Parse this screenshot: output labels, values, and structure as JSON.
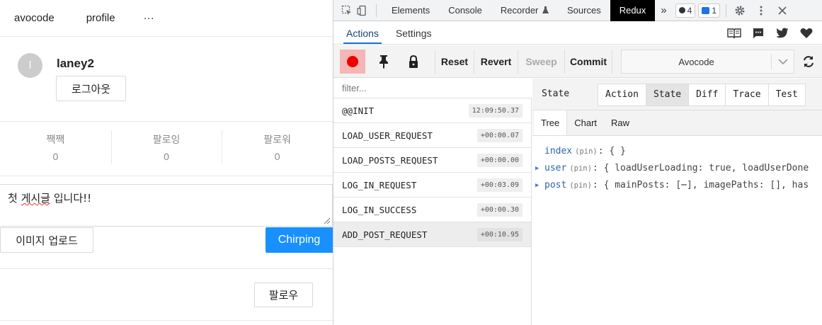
{
  "app": {
    "nav": {
      "home": "avocode",
      "profile": "profile",
      "more": "···"
    },
    "user": {
      "avatar_initial": "l",
      "name": "laney2",
      "logout_label": "로그아웃"
    },
    "stats": [
      {
        "label": "짹짹",
        "value": "0"
      },
      {
        "label": "팔로잉",
        "value": "0"
      },
      {
        "label": "팔로워",
        "value": "0"
      }
    ],
    "composer": {
      "text_before": "첫 ",
      "text_squiggle": "게시글",
      "text_after": " 입니다!!"
    },
    "upload_label": "이미지 업로드",
    "chirp_label": "Chirping",
    "follow_label": "팔로우",
    "accent_color": "#1890ff"
  },
  "devtools": {
    "tabs": [
      "Elements",
      "Console",
      "Recorder",
      "Sources",
      "Redux"
    ],
    "active_tab": "Redux",
    "more_tabs": "»",
    "badge_errors": "4",
    "badge_messages": "1",
    "redux": {
      "top_tabs": [
        "Actions",
        "Settings"
      ],
      "active_top_tab": "Actions",
      "toolbar": {
        "reset": "Reset",
        "revert": "Revert",
        "sweep": "Sweep",
        "commit": "Commit"
      },
      "instance": "Avocode",
      "filter_placeholder": "filter...",
      "actions": [
        {
          "name": "@@INIT",
          "time": "12:09:50.37"
        },
        {
          "name": "LOAD_USER_REQUEST",
          "time": "+00:00.07"
        },
        {
          "name": "LOAD_POSTS_REQUEST",
          "time": "+00:00.00"
        },
        {
          "name": "LOG_IN_REQUEST",
          "time": "+00:03.09"
        },
        {
          "name": "LOG_IN_SUCCESS",
          "time": "+00:00.30"
        },
        {
          "name": "ADD_POST_REQUEST",
          "time": "+00:10.95"
        }
      ],
      "state_title": "State",
      "view_tabs": [
        "Action",
        "State",
        "Diff",
        "Trace",
        "Test"
      ],
      "active_view_tab": "State",
      "sub_tabs": [
        "Tree",
        "Chart",
        "Raw"
      ],
      "active_sub_tab": "Tree",
      "tree": [
        {
          "key": "index",
          "pin": "(pin)",
          "value": ": { }",
          "expandable": false
        },
        {
          "key": "user",
          "pin": "(pin)",
          "value": ": { loadUserLoading: true, loadUserDone",
          "expandable": true
        },
        {
          "key": "post",
          "pin": "(pin)",
          "value": ": { mainPosts: [⋯], imagePaths: [], has",
          "expandable": true
        }
      ]
    }
  }
}
